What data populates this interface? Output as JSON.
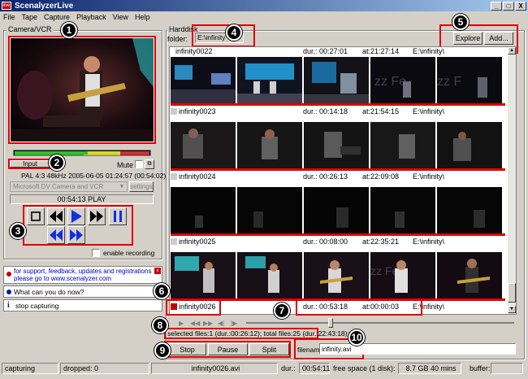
{
  "window": {
    "title": "ScenalyzerLive",
    "min_label": "_",
    "max_label": "□",
    "close_label": "X",
    "app_icon_label": "live"
  },
  "menu": [
    "File",
    "Tape",
    "Capture",
    "Playback",
    "View",
    "Help"
  ],
  "camera_panel": {
    "group_label": "Camera/VCR",
    "input_label": "Input",
    "mute_label": "Mute",
    "info_line": "PAL 4:3 48kHz 2005-06-05 01:24:57 (00:54:02)",
    "device_value": "Microsoft DV Camera and VCR",
    "settings_label": "settings",
    "timecode": "00:54:13 PLAY",
    "enable_recording_label": "enable recording",
    "enable_recording_checked": false
  },
  "info_panel": {
    "support_line1": "for support, feedback, updates and registrations",
    "support_line2": "please go to www.scenalyzer.com",
    "question": "What can you do now?",
    "hint_icon": "i",
    "hint": "stop capturing"
  },
  "harddisk_panel": {
    "group_label": "Harddisk",
    "folder_label": "folder:",
    "folder_value": "E:\\infinity",
    "explore_label": "Explore",
    "add_label": "Add..."
  },
  "clips": [
    {
      "name": "infinity0022",
      "dur": "dur.: 00:27:01",
      "at": "at:21:27:14",
      "path": "E:\\infinity\\"
    },
    {
      "name": "infinity0023",
      "dur": "dur.: 00:14:18",
      "at": "at:21:54:15",
      "path": "E:\\infinity\\"
    },
    {
      "name": "infinity0024",
      "dur": "dur.: 00:26:13",
      "at": "at:22:09:08",
      "path": "E:\\infinity\\"
    },
    {
      "name": "infinity0025",
      "dur": "dur.: 00:08:00",
      "at": "at:22:35:21",
      "path": "E:\\infinity\\"
    },
    {
      "name": "infinity0026",
      "dur": "dur.: 00:53:18",
      "at": "at:00:00:03",
      "path": "E:\\infinity\\"
    }
  ],
  "selection_info": "selected files:1 (dur.:00:26:12); total files:25 (dur.:22:43:18);",
  "capture_buttons": {
    "stop": "Stop",
    "pause": "Pause",
    "split": "Split"
  },
  "filename": {
    "label": "filename:",
    "value": "infinity.avi"
  },
  "status_bar": {
    "state": "capturing",
    "dropped": "dropped: 0",
    "file": "infinity0026.avi",
    "dur_label": "dur.:",
    "dur_value": "00:54:11",
    "free_space": "free space (1 disk):",
    "free_value": "8.7 GB 40 mins",
    "buffer": "buffer:"
  },
  "callouts": [
    "1",
    "2",
    "3",
    "4",
    "5",
    "6",
    "7",
    "8",
    "9",
    "10"
  ],
  "colors": {
    "callout": "#e00000",
    "transport_blue": "#1030e0",
    "title_bar": "#0a246a"
  }
}
